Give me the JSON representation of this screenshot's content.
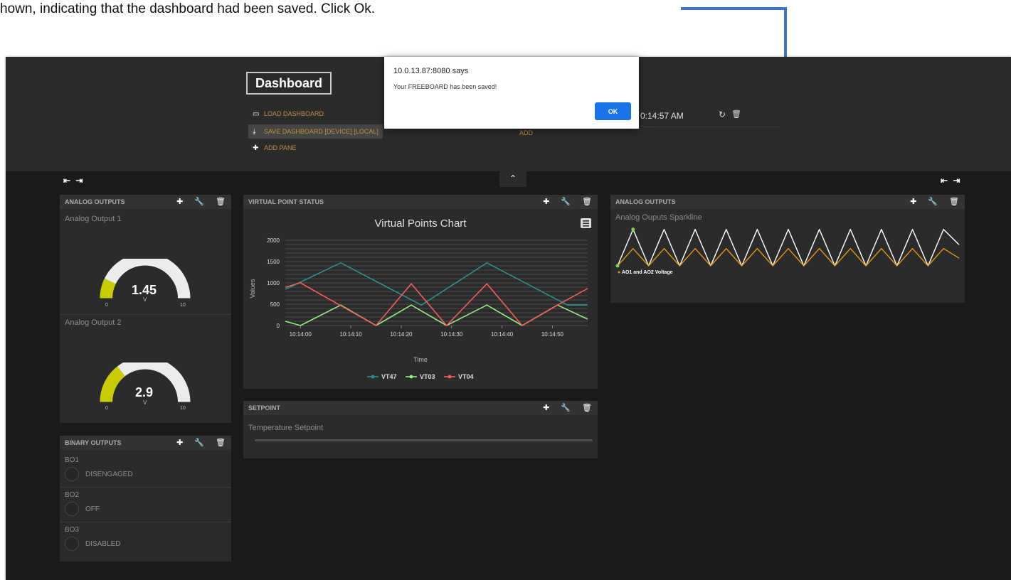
{
  "doc_text": "hown, indicating that the dashboard had been saved. Click Ok.",
  "header": {
    "title": "Dashboard",
    "menu": [
      {
        "label": "LOAD DASHBOARD",
        "icon": "folder-open-icon"
      },
      {
        "label": "SAVE DASHBOARD [DEVICE] [LOCAL]",
        "icon": "download-icon"
      },
      {
        "label": "ADD PANE",
        "icon": "plus-icon"
      }
    ],
    "datasource_time": "0:14:57 AM",
    "datasource_add": "ADD"
  },
  "dialog": {
    "title": "10.0.13.87:8080 says",
    "message": "Your FREEBOARD has been saved!",
    "ok_label": "OK"
  },
  "panes": {
    "analog_outputs_left": {
      "title": "ANALOG OUTPUTS",
      "gauges": [
        {
          "title": "Analog Output 1",
          "value": "1.45",
          "fraction": 0.145,
          "unit": "V",
          "min": "0",
          "max": "10"
        },
        {
          "title": "Analog Output 2",
          "value": "2.9",
          "fraction": 0.29,
          "unit": "V",
          "min": "0",
          "max": "10"
        }
      ]
    },
    "binary_outputs": {
      "title": "BINARY OUTPUTS",
      "items": [
        {
          "label": "BO1",
          "state": "DISENGAGED"
        },
        {
          "label": "BO2",
          "state": "OFF"
        },
        {
          "label": "BO3",
          "state": "DISABLED"
        }
      ]
    },
    "virtual_point_status": {
      "title": "VIRTUAL POINT STATUS"
    },
    "setpoint": {
      "title": "SETPOINT",
      "widget_title": "Temperature Setpoint"
    },
    "analog_outputs_right": {
      "title": "ANALOG OUTPUTS",
      "widget_title": "Analog Ouputs Sparkline",
      "legend": "AO1 and AO2 Voltage"
    }
  },
  "colors": {
    "gauge_fill": "#c8cc00",
    "gauge_track": "#ececec",
    "accent_link": "#c78c3b",
    "ok_button": "#1a73e8",
    "annotation_arrow": "#4472c4"
  },
  "chart_data": {
    "type": "line",
    "title": "Virtual Points Chart",
    "xlabel": "Time",
    "ylabel": "Values",
    "ylim": [
      0,
      2000
    ],
    "yticks": [
      "0",
      "500",
      "1000",
      "1500",
      "2000"
    ],
    "xticks": [
      "10:14:00",
      "10:14:10",
      "10:14:20",
      "10:14:30",
      "10:14:40",
      "10:14:50"
    ],
    "x_range_seconds": [
      -3,
      57
    ],
    "grid": true,
    "legend_position": "bottom",
    "series": [
      {
        "name": "VT47",
        "color": "#2b908f",
        "points": [
          [
            -3,
            850
          ],
          [
            8,
            1470
          ],
          [
            24,
            480
          ],
          [
            37,
            1470
          ],
          [
            53,
            480
          ],
          [
            57,
            480
          ]
        ]
      },
      {
        "name": "VT03",
        "color": "#90ee7e",
        "points": [
          [
            -3,
            100
          ],
          [
            0,
            0
          ],
          [
            8,
            480
          ],
          [
            15,
            0
          ],
          [
            22,
            480
          ],
          [
            29,
            0
          ],
          [
            37,
            480
          ],
          [
            44,
            0
          ],
          [
            51,
            480
          ],
          [
            57,
            150
          ]
        ]
      },
      {
        "name": "VT04",
        "color": "#f45b5b",
        "points": [
          [
            -3,
            900
          ],
          [
            0,
            1000
          ],
          [
            15,
            0
          ],
          [
            22,
            980
          ],
          [
            29,
            0
          ],
          [
            37,
            980
          ],
          [
            44,
            0
          ],
          [
            51,
            480
          ],
          [
            57,
            870
          ]
        ]
      }
    ]
  },
  "sparkline_data": {
    "type": "line",
    "series": [
      {
        "name": "AO1",
        "color": "#ffffff",
        "points": [
          0,
          0.95,
          0,
          0.95,
          0,
          0.95,
          0,
          0.95,
          0,
          0.95,
          0,
          0.95,
          0,
          0.95,
          0,
          0.95,
          0,
          0.95,
          0,
          0.95,
          0,
          0.95,
          0.55
        ]
      },
      {
        "name": "AO2",
        "color": "#e8940c",
        "points": [
          0,
          0.45,
          0,
          0.45,
          0,
          0.45,
          0,
          0.45,
          0,
          0.45,
          0,
          0.45,
          0,
          0.45,
          0,
          0.45,
          0,
          0.45,
          0,
          0.45,
          0,
          0.45,
          0.2
        ]
      }
    ]
  }
}
